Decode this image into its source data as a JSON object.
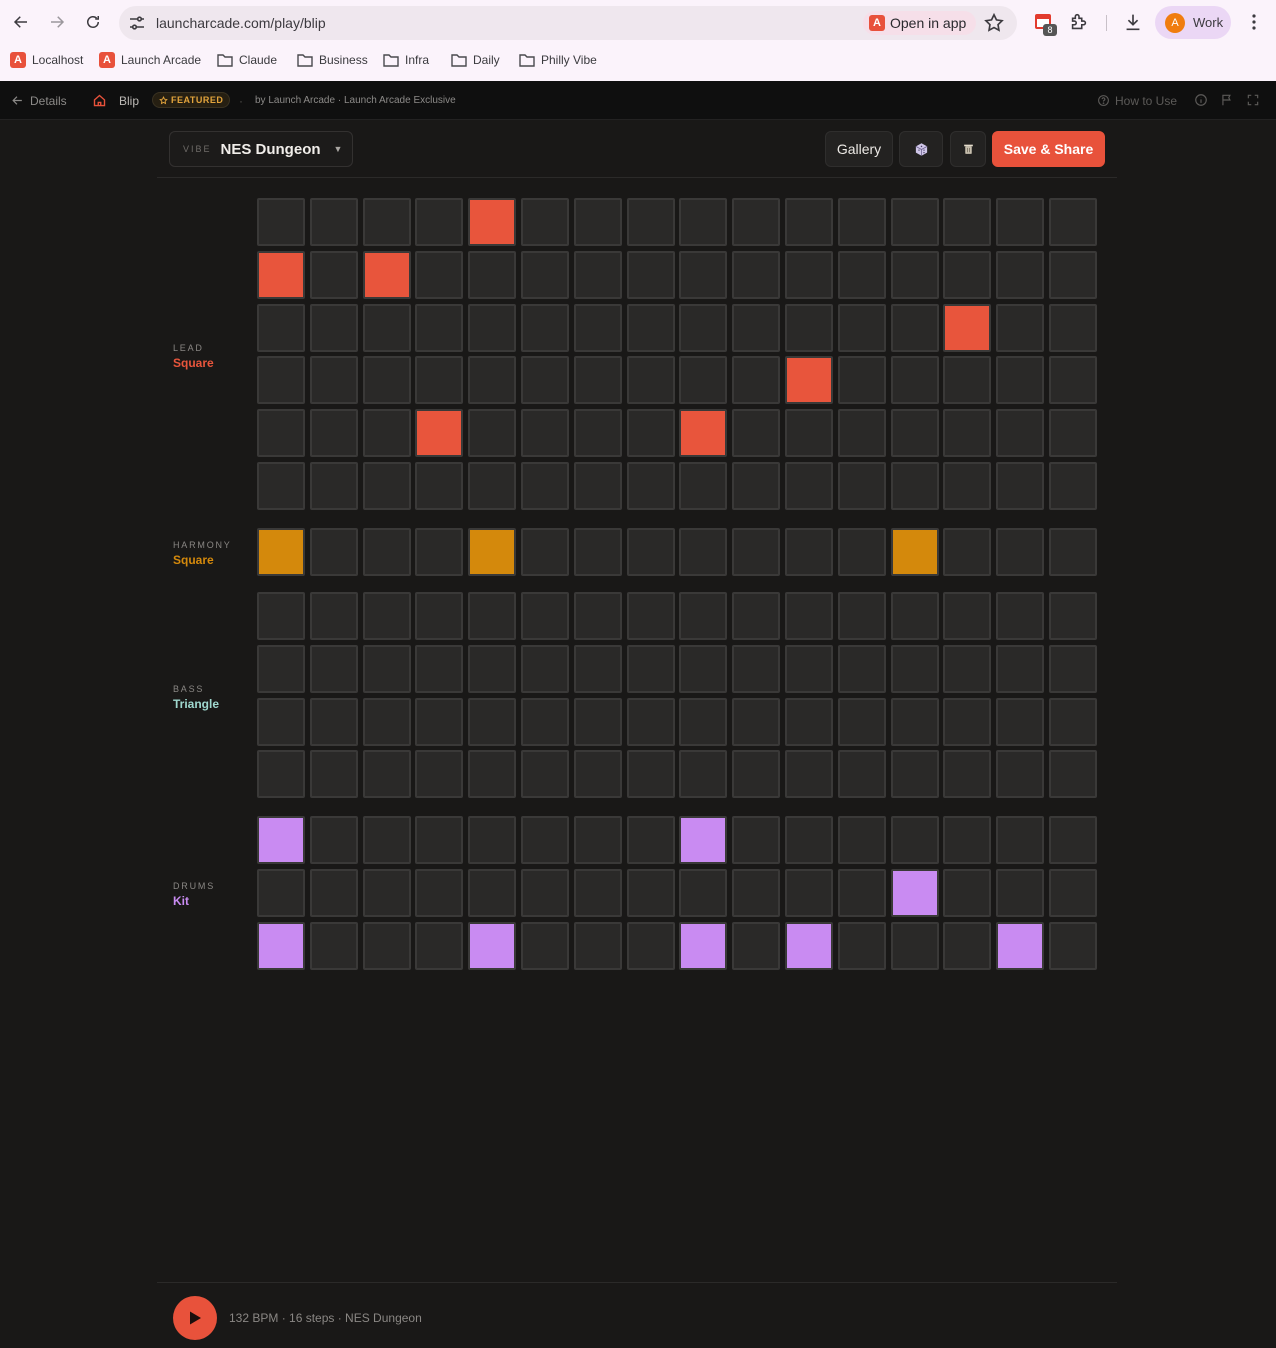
{
  "browser": {
    "url": "launcharcade.com/play/blip",
    "open_in_app": "Open in app",
    "extension_badge": "8",
    "profile_initial": "A",
    "profile_name": "Work",
    "bookmarks": [
      "Localhost",
      "Launch Arcade",
      "Claude",
      "Business",
      "Infra",
      "Daily",
      "Philly Vibe"
    ]
  },
  "app_header": {
    "back_label": "Details",
    "game_name": "Blip",
    "featured_label": "FEATURED",
    "dot": "·",
    "byline": "by Launch Arcade · Launch Arcade Exclusive",
    "how_to_use": "How to Use"
  },
  "topbar": {
    "vibe_label": "VIBE",
    "vibe_name": "NES Dungeon",
    "gallery_label": "Gallery",
    "save_share_label": "Save & Share"
  },
  "colors": {
    "lead": "#e8553c",
    "harmony": "#d4890c",
    "bass": "#9fd8cf",
    "drums": "#c98bf2",
    "accent": "#e8523b"
  },
  "tracks": [
    {
      "name": "LEAD",
      "instrument": "Square",
      "color_key": "lead",
      "rows": [
        [
          0,
          0,
          0,
          0,
          1,
          0,
          0,
          0,
          0,
          0,
          0,
          0,
          0,
          0,
          0,
          0
        ],
        [
          1,
          0,
          1,
          0,
          0,
          0,
          0,
          0,
          0,
          0,
          0,
          0,
          0,
          0,
          0,
          0
        ],
        [
          0,
          0,
          0,
          0,
          0,
          0,
          0,
          0,
          0,
          0,
          0,
          0,
          0,
          1,
          0,
          0
        ],
        [
          0,
          0,
          0,
          0,
          0,
          0,
          0,
          0,
          0,
          0,
          1,
          0,
          0,
          0,
          0,
          0
        ],
        [
          0,
          0,
          0,
          1,
          0,
          0,
          0,
          0,
          1,
          0,
          0,
          0,
          0,
          0,
          0,
          0
        ],
        [
          0,
          0,
          0,
          0,
          0,
          0,
          0,
          0,
          0,
          0,
          0,
          0,
          0,
          0,
          0,
          0
        ]
      ]
    },
    {
      "name": "HARMONY",
      "instrument": "Square",
      "color_key": "harmony",
      "rows": [
        [
          1,
          0,
          0,
          0,
          1,
          0,
          0,
          0,
          0,
          0,
          0,
          0,
          1,
          0,
          0,
          0
        ]
      ]
    },
    {
      "name": "BASS",
      "instrument": "Triangle",
      "color_key": "bass",
      "rows": [
        [
          0,
          0,
          0,
          0,
          0,
          0,
          0,
          0,
          0,
          0,
          0,
          0,
          0,
          0,
          0,
          0
        ],
        [
          0,
          0,
          0,
          0,
          0,
          0,
          0,
          0,
          0,
          0,
          0,
          0,
          0,
          0,
          0,
          0
        ],
        [
          0,
          0,
          0,
          0,
          0,
          0,
          0,
          0,
          0,
          0,
          0,
          0,
          0,
          0,
          0,
          0
        ],
        [
          0,
          0,
          0,
          0,
          0,
          0,
          0,
          0,
          0,
          0,
          0,
          0,
          0,
          0,
          0,
          0
        ]
      ]
    },
    {
      "name": "DRUMS",
      "instrument": "Kit",
      "color_key": "drums",
      "rows": [
        [
          1,
          0,
          0,
          0,
          0,
          0,
          0,
          0,
          1,
          0,
          0,
          0,
          0,
          0,
          0,
          0
        ],
        [
          0,
          0,
          0,
          0,
          0,
          0,
          0,
          0,
          0,
          0,
          0,
          0,
          1,
          0,
          0,
          0
        ],
        [
          1,
          0,
          0,
          0,
          1,
          0,
          0,
          0,
          1,
          0,
          1,
          0,
          0,
          0,
          1,
          0
        ]
      ]
    }
  ],
  "footer": {
    "status": "132 BPM · 16 steps · NES Dungeon"
  }
}
